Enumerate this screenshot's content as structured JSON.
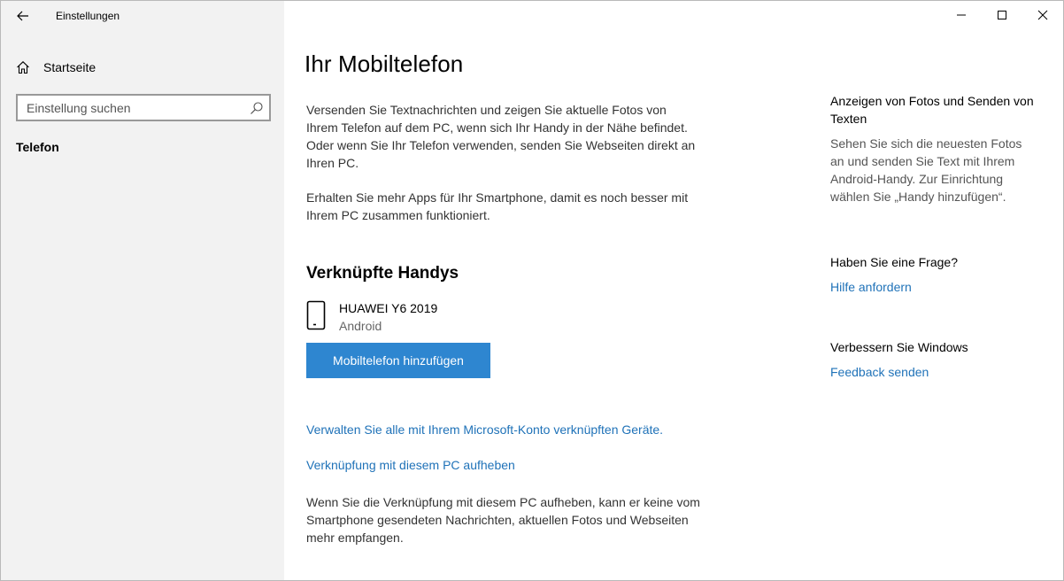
{
  "window": {
    "app_title": "Einstellungen"
  },
  "sidebar": {
    "home_label": "Startseite",
    "search_placeholder": "Einstellung suchen",
    "nav_items": [
      {
        "label": "Telefon"
      }
    ]
  },
  "main": {
    "title": "Ihr Mobiltelefon",
    "intro_text": "Versenden Sie Textnachrichten und zeigen Sie aktuelle Fotos von Ihrem Telefon auf dem PC, wenn sich Ihr Handy in der Nähe befindet. Oder wenn Sie Ihr Telefon verwenden, senden Sie Webseiten direkt an Ihren PC.",
    "apps_text": "Erhalten Sie mehr Apps für Ihr Smartphone, damit es noch besser mit Ihrem PC zusammen funktioniert.",
    "linked_section_title": "Verknüpfte Handys",
    "device": {
      "name": "HUAWEI Y6 2019",
      "os": "Android"
    },
    "add_phone_button": "Mobiltelefon hinzufügen",
    "manage_devices_link": "Verwalten Sie alle mit Ihrem Microsoft-Konto verknüpften Geräte.",
    "unlink_link": "Verknüpfung mit diesem PC aufheben",
    "unlink_text": "Wenn Sie die Verknüpfung mit diesem PC aufheben, kann er keine vom Smartphone gesendeten Nachrichten, aktuellen Fotos und Webseiten mehr empfangen."
  },
  "right_panel": {
    "photos_heading": "Anzeigen von Fotos und Senden von Texten",
    "photos_text": "Sehen Sie sich die neuesten Fotos an und senden Sie Text mit Ihrem Android-Handy. Zur Einrichtung wählen Sie „Handy hinzufügen“.",
    "question_heading": "Haben Sie eine Frage?",
    "help_link": "Hilfe anfordern",
    "improve_heading": "Verbessern Sie Windows",
    "feedback_link": "Feedback senden"
  },
  "icons": {
    "back": "back-arrow-icon",
    "home": "home-icon",
    "search": "search-icon",
    "phone": "phone-icon",
    "minimize": "minimize-icon",
    "maximize": "maximize-icon",
    "close": "close-icon"
  },
  "colors": {
    "accent": "#2e86d0",
    "link": "#1f72b8",
    "sidebar_bg": "#f2f2f2"
  }
}
